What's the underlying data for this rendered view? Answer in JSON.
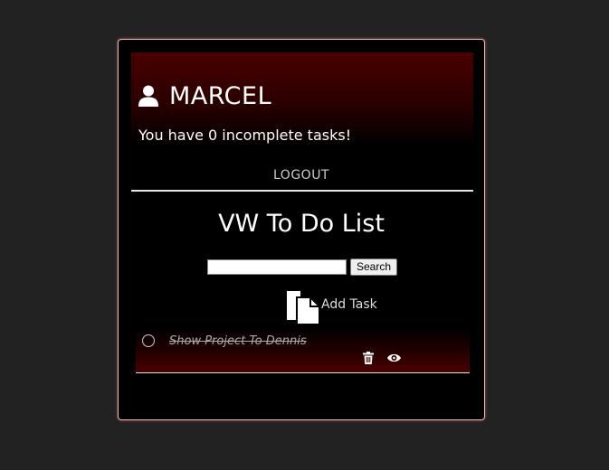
{
  "header": {
    "username": "MARCEL",
    "incomplete_message": "You have 0 incomplete tasks!",
    "user_icon": "user-icon"
  },
  "nav": {
    "logout_label": "LOGOUT"
  },
  "app": {
    "title": "VW To Do List"
  },
  "search": {
    "value": "",
    "button_label": "Search"
  },
  "add_task": {
    "label": "Add Task",
    "icon": "copy-document-icon"
  },
  "tasks": [
    {
      "text": "Show Project To Dennis",
      "completed": true,
      "actions": [
        "trash-icon",
        "eye-icon"
      ]
    }
  ],
  "colors": {
    "page_background": "#222222",
    "card_background": "#000000",
    "accent_dark_red": "#4a0000",
    "text": "#ffffff"
  }
}
